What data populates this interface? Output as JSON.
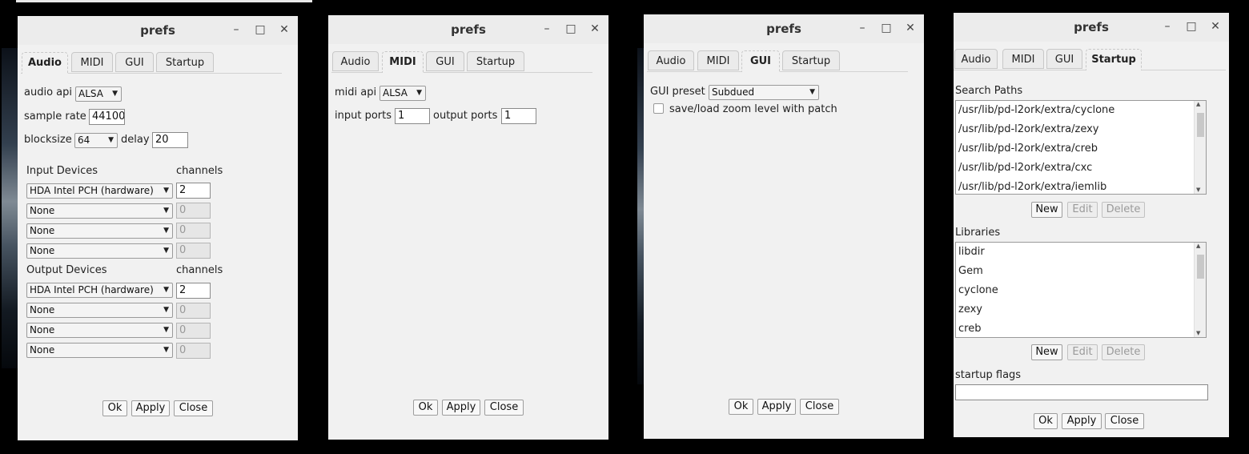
{
  "window_title": "prefs",
  "controls": {
    "minimize": "–",
    "maximize": "□",
    "close": "✕"
  },
  "tabs": [
    "Audio",
    "MIDI",
    "GUI",
    "Startup"
  ],
  "buttons": {
    "ok": "Ok",
    "apply": "Apply",
    "close": "Close",
    "new": "New",
    "edit": "Edit",
    "delete": "Delete"
  },
  "arrow": "▼",
  "audio": {
    "api_label": "audio api",
    "api_value": "ALSA",
    "sample_rate_label": "sample rate",
    "sample_rate_value": "44100",
    "blocksize_label": "blocksize",
    "blocksize_value": "64",
    "delay_label": "delay",
    "delay_value": "20",
    "input_header": "Input Devices",
    "output_header": "Output Devices",
    "channels_header": "channels",
    "input_devices": [
      {
        "device": "HDA Intel PCH (hardware)",
        "channels": "2"
      },
      {
        "device": "None",
        "channels": "0"
      },
      {
        "device": "None",
        "channels": "0"
      },
      {
        "device": "None",
        "channels": "0"
      }
    ],
    "output_devices": [
      {
        "device": "HDA Intel PCH (hardware)",
        "channels": "2"
      },
      {
        "device": "None",
        "channels": "0"
      },
      {
        "device": "None",
        "channels": "0"
      },
      {
        "device": "None",
        "channels": "0"
      }
    ]
  },
  "midi": {
    "api_label": "midi api",
    "api_value": "ALSA",
    "input_ports_label": "input ports",
    "input_ports_value": "1",
    "output_ports_label": "output ports",
    "output_ports_value": "1"
  },
  "gui": {
    "preset_label": "GUI preset",
    "preset_value": "Subdued",
    "zoom_label": "save/load zoom level with patch",
    "zoom_checked": false
  },
  "startup": {
    "search_paths_label": "Search Paths",
    "search_paths": [
      "/usr/lib/pd-l2ork/extra/cyclone",
      "/usr/lib/pd-l2ork/extra/zexy",
      "/usr/lib/pd-l2ork/extra/creb",
      "/usr/lib/pd-l2ork/extra/cxc",
      "/usr/lib/pd-l2ork/extra/iemlib"
    ],
    "libraries_label": "Libraries",
    "libraries": [
      "libdir",
      "Gem",
      "cyclone",
      "zexy",
      "creb"
    ],
    "flags_label": "startup flags",
    "flags_value": ""
  }
}
